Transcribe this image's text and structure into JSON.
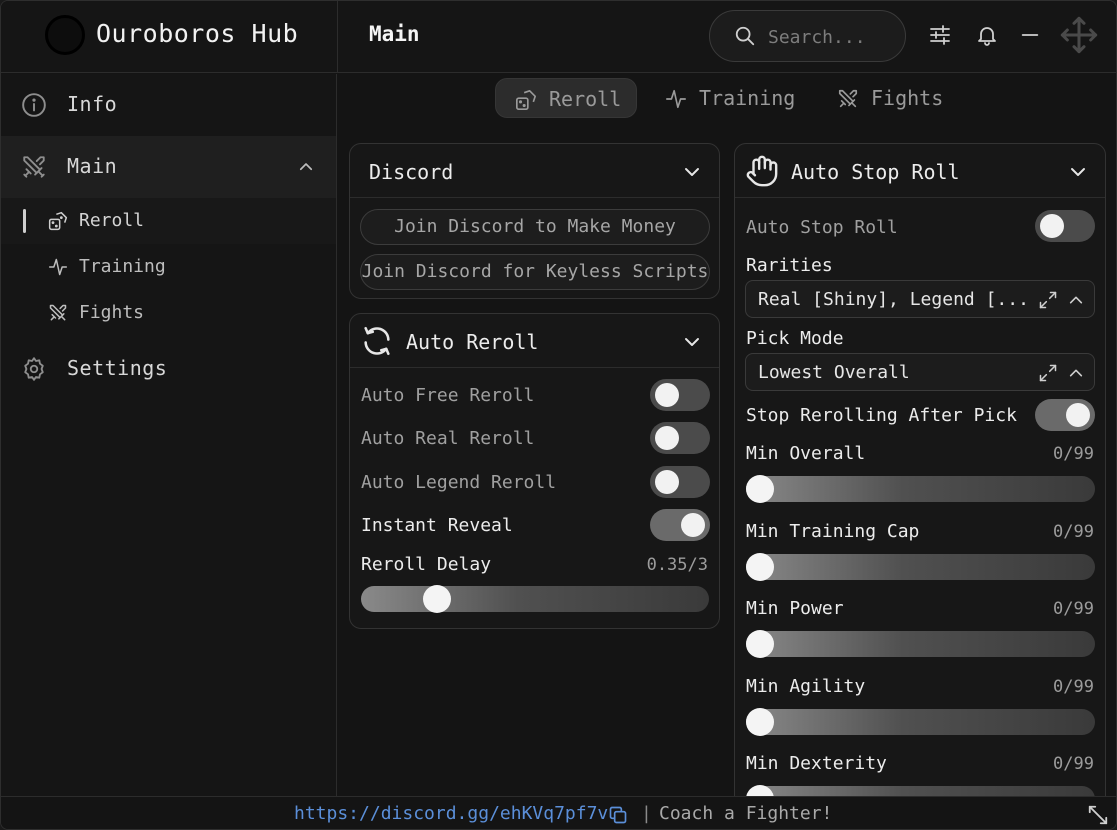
{
  "app": {
    "title": "Ouroboros Hub",
    "page_title": "Main"
  },
  "search": {
    "placeholder": "Search..."
  },
  "sidebar": {
    "items": [
      {
        "label": "Info",
        "icon": "info-icon"
      },
      {
        "label": "Main",
        "icon": "swords-icon",
        "expanded": true
      },
      {
        "label": "Settings",
        "icon": "gear-icon"
      }
    ],
    "sub_items": [
      {
        "label": "Reroll",
        "icon": "dice-icon",
        "active": true
      },
      {
        "label": "Training",
        "icon": "activity-icon"
      },
      {
        "label": "Fights",
        "icon": "swords-icon"
      }
    ]
  },
  "tabs": [
    {
      "label": "Reroll",
      "icon": "dice-icon",
      "active": true
    },
    {
      "label": "Training",
      "icon": "activity-icon"
    },
    {
      "label": "Fights",
      "icon": "swords-icon"
    }
  ],
  "discord_panel": {
    "title": "Discord",
    "buttons": [
      "Join Discord to Make Money",
      "Join Discord for Keyless Scripts"
    ]
  },
  "auto_reroll_panel": {
    "title": "Auto Reroll",
    "toggles": [
      {
        "label": "Auto Free Reroll",
        "on": false
      },
      {
        "label": "Auto Real Reroll",
        "on": false
      },
      {
        "label": "Auto Legend Reroll",
        "on": false
      },
      {
        "label": "Instant Reveal",
        "on": true
      }
    ],
    "slider": {
      "label": "Reroll Delay",
      "value_text": "0.35/3",
      "value": 0.35,
      "max": 3
    }
  },
  "auto_stop_panel": {
    "title": "Auto Stop Roll",
    "toggle_label": "Auto Stop Roll",
    "toggle_on": false,
    "rarities_label": "Rarities",
    "rarities_value": "Real [Shiny], Legend [...",
    "pick_mode_label": "Pick Mode",
    "pick_mode_value": "Lowest Overall",
    "stop_label": "Stop Rerolling After Pick",
    "stop_on": true,
    "sliders": [
      {
        "label": "Min Overall",
        "value_text": "0/99",
        "value": 0
      },
      {
        "label": "Min Training Cap",
        "value_text": "0/99",
        "value": 0
      },
      {
        "label": "Min Power",
        "value_text": "0/99",
        "value": 0
      },
      {
        "label": "Min Agility",
        "value_text": "0/99",
        "value": 0
      },
      {
        "label": "Min Dexterity",
        "value_text": "0/99",
        "value": 0
      }
    ]
  },
  "footer": {
    "link": "https://discord.gg/ehKVq7pf7v",
    "separator": "|",
    "message": "Coach a Fighter!"
  }
}
